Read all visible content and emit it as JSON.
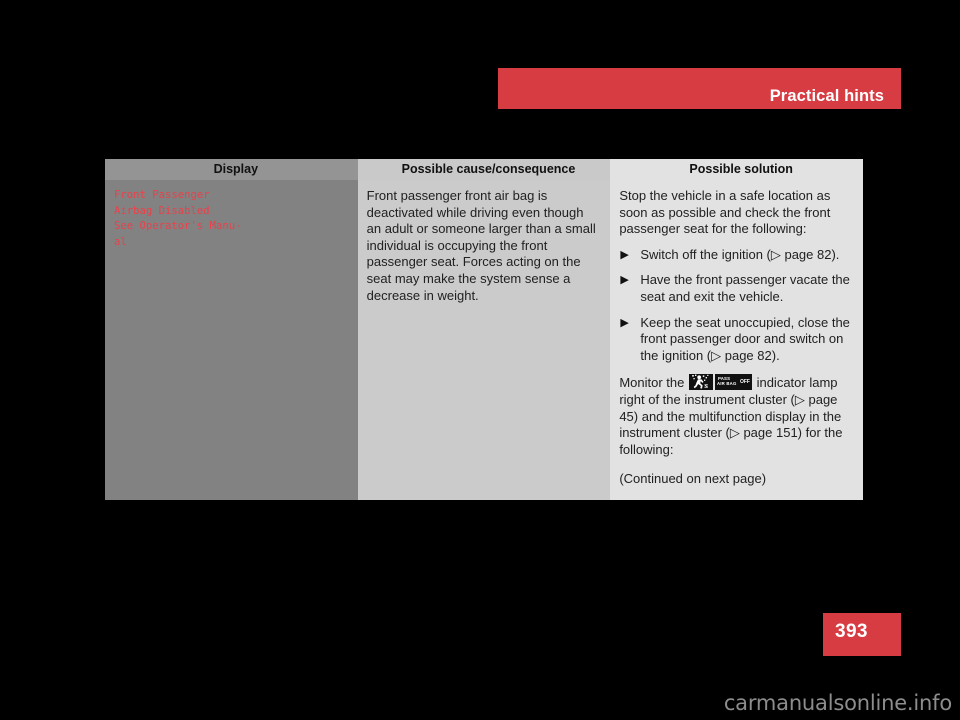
{
  "page": {
    "section_title": "Practical hints",
    "page_number": "393",
    "watermark": "carmanualsonline.info",
    "accent_color": "#d83c43"
  },
  "table": {
    "headers": {
      "display": "Display",
      "cause": "Possible cause/consequence",
      "solution": "Possible solution"
    },
    "row": {
      "display_text": "Front Passenger\nAirbag Disabled\nSee Operator's Manu-\nal",
      "cause_text": "Front passenger front air bag is deactivated while driving even though an adult or someone larger than a small individual is occupying the front passenger seat. Forces acting on the seat may make the system sense a decrease in weight.",
      "solution": {
        "intro": "Stop the vehicle in a safe location as soon as possible and check the front passenger seat for the following:",
        "bullets": [
          "Switch off the ignition (▷ page 82).",
          "Have the front passenger vacate the seat and exit the vehicle.",
          "Keep the seat unoccupied, close the front passenger door and switch on the ignition (▷ page 82)."
        ],
        "monitor_prefix": "Monitor the",
        "monitor_suffix": "indicator lamp right of the instrument cluster (▷ page 45) and the multifunction display in the instrument cluster (▷ page 151) for the following:",
        "continued": "(Continued on next page)",
        "lamps": [
          {
            "name": "airbag-occupant-figure-lamp",
            "label": ""
          },
          {
            "name": "pass-air-bag-off-lamp",
            "line1": "PASS",
            "line2": "AIR BAG",
            "line3": "OFF"
          }
        ]
      }
    }
  }
}
